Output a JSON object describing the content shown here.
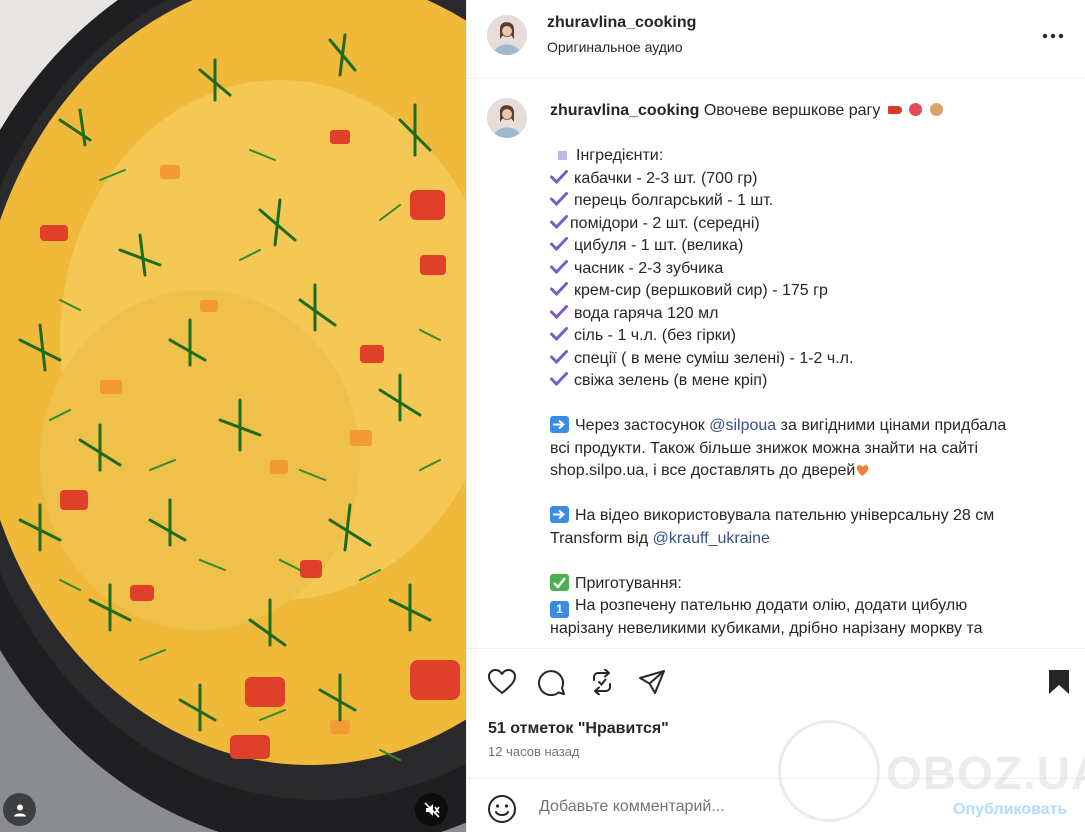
{
  "post": {
    "username": "zhuravlina_cooking",
    "audio": "Оригинальное аудио",
    "caption_title": "Овочеве вершкове рагу"
  },
  "ingredients": {
    "heading": "Інгредієнти:",
    "items": [
      "кабачки - 2-3 шт. (700 гр)",
      "перець болгарський - 1 шт.",
      "помідори - 2 шт. (середні)",
      "цибуля - 1 шт. (велика)",
      "часник - 2-3 зубчика",
      "крем-сир (вершковий сир) - 175 гр",
      "вода гаряча 120 мл",
      "сіль - 1 ч.л. (без гірки)",
      "спеції ( в мене суміш зелені) - 1-2 ч.л.",
      "свіжа зелень (в мене кріп)"
    ]
  },
  "para1": {
    "before": "Через застосунок ",
    "mention": "@silpoua",
    "after1": " за вигідними цінами придбала",
    "line2": "всі продукти. Також більше знижок можна знайти на сайті",
    "line3": "shop.silpo.ua, і все доставлять до дверей"
  },
  "para2": {
    "line1": "На відео використовувала пательню універсальну 28 см",
    "line2_before": "Transform від ",
    "mention": "@krauff_ukraine"
  },
  "prep": {
    "heading": "Приготування:",
    "step_num": "1",
    "line1": "На розпечену пательню додати олію, додати цибулю",
    "line2": "нарізану невеликими кубиками, дрібно нарізану моркву та"
  },
  "footer": {
    "likes": "51 отметок \"Нравится\"",
    "time": "12 часов назад",
    "comment_placeholder": "Добавьте комментарий...",
    "publish": "Опубликовать"
  },
  "watermark": {
    "text": "OBOZ.UA"
  },
  "icons": {
    "more": "more-horizontal-icon",
    "like": "heart-icon",
    "comment": "comment-icon",
    "repost": "repost-icon",
    "share": "send-icon",
    "save": "bookmark-icon",
    "emoji": "smile-icon",
    "mute": "speaker-muted-icon",
    "user": "user-icon"
  },
  "colors": {
    "text": "#262626",
    "muted": "#737373",
    "link": "#385185",
    "publish": "#b3dbff",
    "check": "#7b5cc6"
  }
}
